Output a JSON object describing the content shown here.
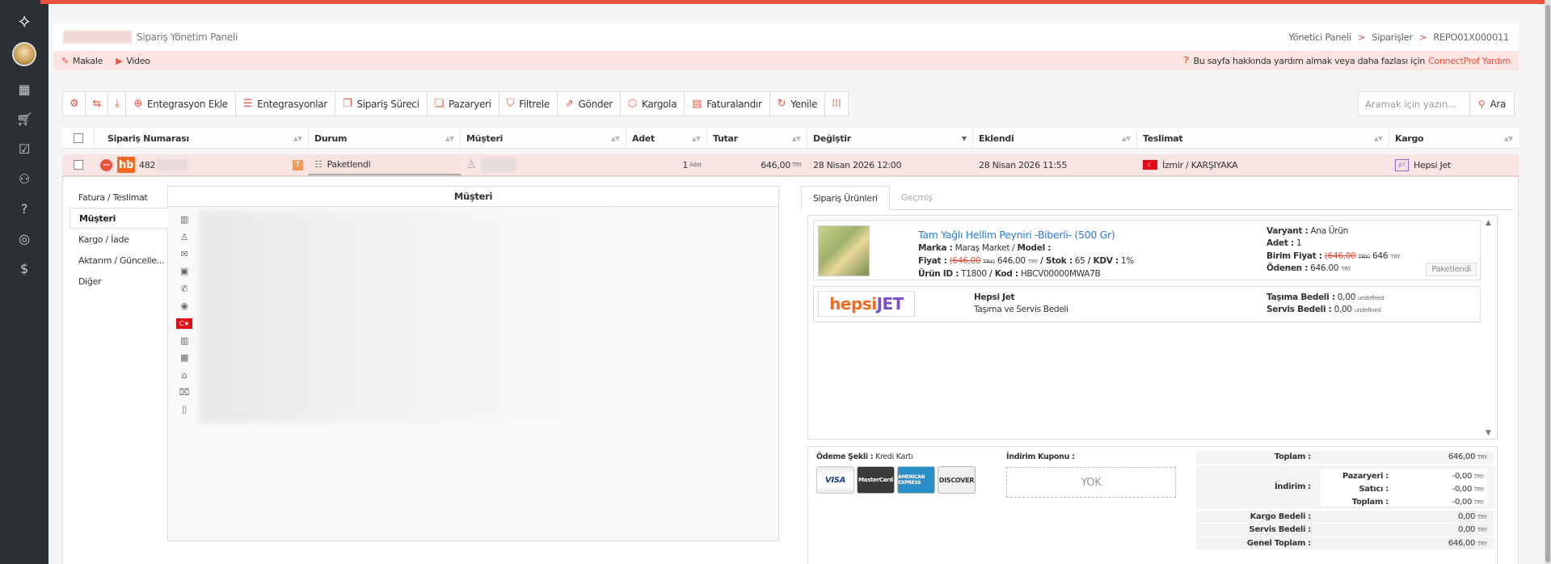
{
  "header": {
    "title": "Sipariş Yönetim Paneli",
    "breadcrumb": [
      "Yönetici Paneli",
      "Siparişler",
      "REPO01X000011"
    ]
  },
  "help": {
    "article": "Makale",
    "video": "Video",
    "text": "Bu sayfa hakkında yardım almak veya daha fazlası için",
    "link": "ConnectProf Yardım"
  },
  "toolbar": {
    "integration_add": "Entegrasyon Ekle",
    "integrations": "Entegrasyonlar",
    "order_process": "Sipariş Süreci",
    "marketplaces": "Pazaryeri",
    "filter": "Filtrele",
    "send": "Gönder",
    "ship": "Kargola",
    "invoice": "Faturalandır",
    "refresh": "Yenile"
  },
  "search": {
    "placeholder": "Aramak için yazın...",
    "button": "Ara"
  },
  "table": {
    "columns": [
      "Sipariş Numarası",
      "Durum",
      "Müşteri",
      "Adet",
      "Tutar",
      "Değiştir",
      "Eklendi",
      "Teslimat",
      "Kargo"
    ],
    "row": {
      "order_no": "482",
      "marketplace_badge": "hb",
      "t_badge": "T",
      "status": "Paketlendi",
      "qty": "1",
      "qty_unit": "Adet",
      "amount": "646,00",
      "currency": "TRY",
      "modified": "28 Nisan 2026 12:00",
      "added": "28 Nisan 2026 11:55",
      "delivery": "İzmir / KARŞIYAKA",
      "cargo_badge": "JET",
      "cargo": "Hepsi Jet"
    }
  },
  "left_nav": [
    "Fatura / Teslimat",
    "Müşteri",
    "Kargo / İade",
    "Aktarım / Güncelle...",
    "Diğer"
  ],
  "customer_panel": {
    "title": "Müşteri",
    "flag": "C★"
  },
  "tabs": [
    "Sipariş Ürünleri",
    "Geçmiş"
  ],
  "product": {
    "name": "Tam Yağlı Hellim Peyniri -Biberli- (500 Gr)",
    "brand_label": "Marka :",
    "brand": "Maraş Market",
    "model_label": "Model :",
    "price_label": "Fiyat :",
    "old_price": "(646,00",
    "old_price_unit": "TRY)",
    "price": "646,00",
    "price_unit": "TRY",
    "stock_label": "/ Stok :",
    "stock": "65",
    "kdv_label": "/ KDV :",
    "kdv": "1%",
    "id_label": "Ürün ID :",
    "id": "T1800",
    "code_label": "/ Kod :",
    "code": "HBCV00000MWA7B",
    "variant_label": "Varyant :",
    "variant": "Ana Ürün",
    "qty_label": "Adet :",
    "qty": "1",
    "unit_price_label": "Birim Fiyat :",
    "unit_old": "(646,00",
    "unit_old_unit": "TRY)",
    "unit_price": "646",
    "unit_price_unit": "TRY",
    "paid_label": "Ödenen :",
    "paid": "646.00",
    "paid_unit": "TRY",
    "status": "Paketlendi"
  },
  "shipping": {
    "logo_a": "hepsi",
    "logo_b": "JET",
    "name": "Hepsi Jet",
    "desc": "Taşıma ve Servis Bedeli",
    "transport_label": "Taşıma Bedeli :",
    "transport": "0,00",
    "transport_unit": "undefined",
    "service_label": "Servis Bedeli :",
    "service": "0,00",
    "service_unit": "undefined"
  },
  "payment": {
    "method_label": "Ödeme Şekli :",
    "method": "Kredi Kartı",
    "cards": [
      "VISA",
      "MasterCard",
      "AMERICAN EXPRESS",
      "DISCOVER"
    ],
    "coupon_label": "İndirim Kuponu :",
    "coupon": "YOK"
  },
  "totals": {
    "total_label": "Toplam :",
    "total": "646,00",
    "discount_label": "İndirim :",
    "marketplace_label": "Pazaryeri :",
    "marketplace": "-0,00",
    "seller_label": "Satıcı :",
    "seller": "-0,00",
    "disc_total_label": "Toplam :",
    "disc_total": "-0,00",
    "cargo_label": "Kargo Bedeli :",
    "cargo": "0,00",
    "service_label": "Servis Bedeli :",
    "service": "0,00",
    "grand_label": "Genel Toplam :",
    "grand": "646,00",
    "unit": "TRY"
  },
  "colors": {
    "accent": "#e8523f",
    "sidebar": "#2b3035",
    "row_highlight": "#f8e5e3",
    "link": "#2b7bd8"
  }
}
